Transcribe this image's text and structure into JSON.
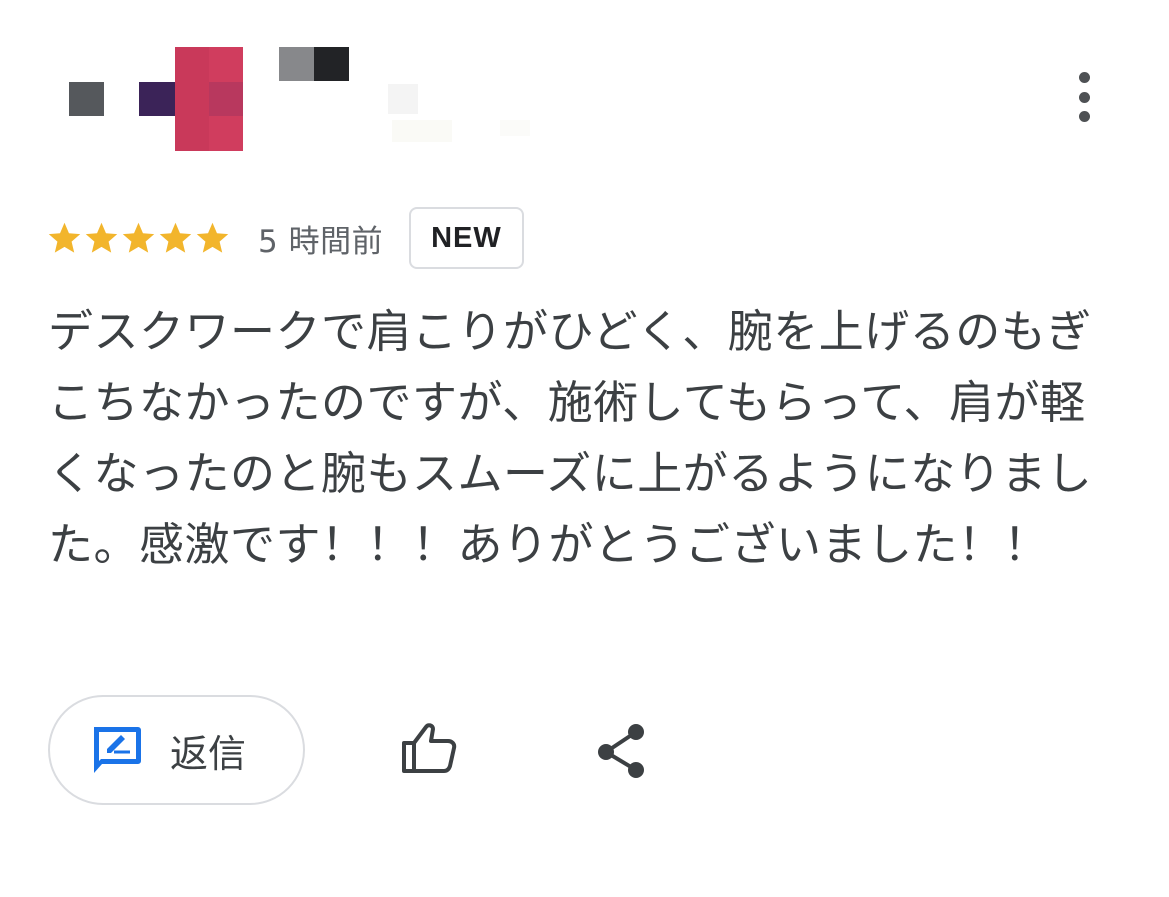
{
  "review": {
    "rating": 5,
    "max_rating": 5,
    "time_ago": "5 時間前",
    "badge": "NEW",
    "text": "デスクワークで肩こりがひどく、腕を上げるのもぎこちなかったのですが、施術してもらって、肩が軽くなったのと腕もスムーズに上がるようになりました。感激です！！！ありがとうございました！！"
  },
  "actions": {
    "reply_label": "返信",
    "reply_icon": "reply-edit-icon",
    "like_icon": "thumbs-up-icon",
    "share_icon": "share-icon",
    "more_icon": "more-vert-icon"
  },
  "colors": {
    "star": "#f2b52c",
    "accent_blue": "#1a73e8",
    "text": "#3c4043",
    "border": "#dadce0"
  }
}
